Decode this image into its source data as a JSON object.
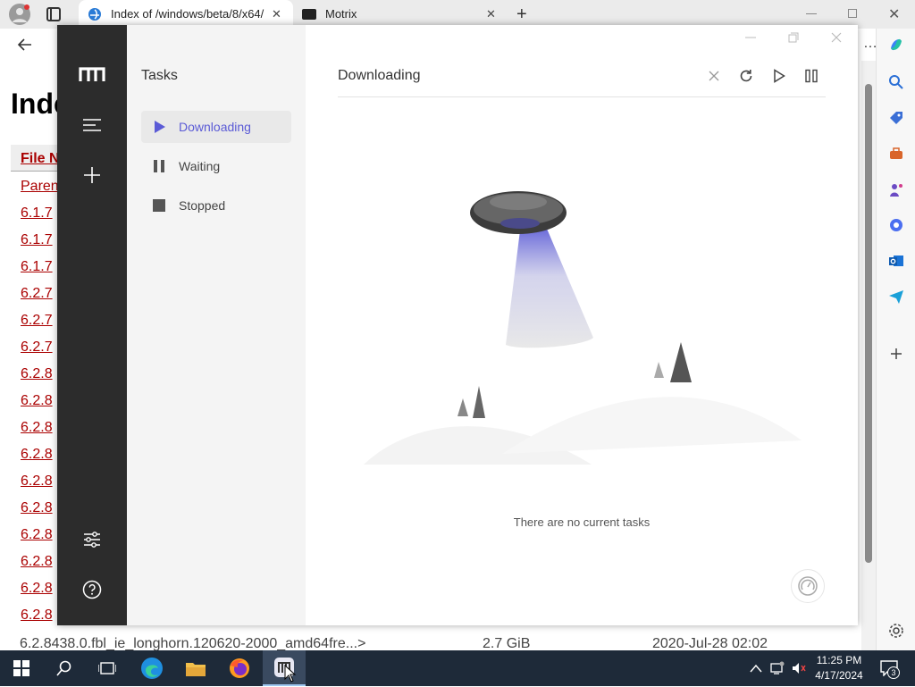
{
  "browser": {
    "tabs": [
      {
        "title": "Index of /windows/beta/8/x64/",
        "active": true
      },
      {
        "title": "Motrix",
        "active": false
      }
    ],
    "page": {
      "title_visible": "Inde",
      "header_visible": "File N",
      "rows": [
        "Paren",
        "6.1.7",
        "6.1.7",
        "6.1.7",
        "6.2.7",
        "6.2.7",
        "6.2.7",
        "6.2.8",
        "6.2.8",
        "6.2.8",
        "6.2.8",
        "6.2.8",
        "6.2.8",
        "6.2.8",
        "6.2.8",
        "6.2.8",
        "6.2.8"
      ],
      "last_row": {
        "name": "6.2.8438.0.fbl_ie_longhorn.120620-2000_amd64fre...>",
        "size": "2.7 GiB",
        "date": "2020-Jul-28 02:02"
      }
    }
  },
  "motrix": {
    "sidebar": {
      "title": "Tasks",
      "items": [
        {
          "label": "Downloading",
          "icon": "play-icon",
          "active": true
        },
        {
          "label": "Waiting",
          "icon": "pause-icon",
          "active": false
        },
        {
          "label": "Stopped",
          "icon": "stop-icon",
          "active": false
        }
      ]
    },
    "main": {
      "title": "Downloading",
      "empty_message": "There are no current tasks"
    },
    "accent_color": "#5b5bd6"
  },
  "taskbar": {
    "time": "11:25 PM",
    "date": "4/17/2024",
    "notification_count": "3"
  }
}
